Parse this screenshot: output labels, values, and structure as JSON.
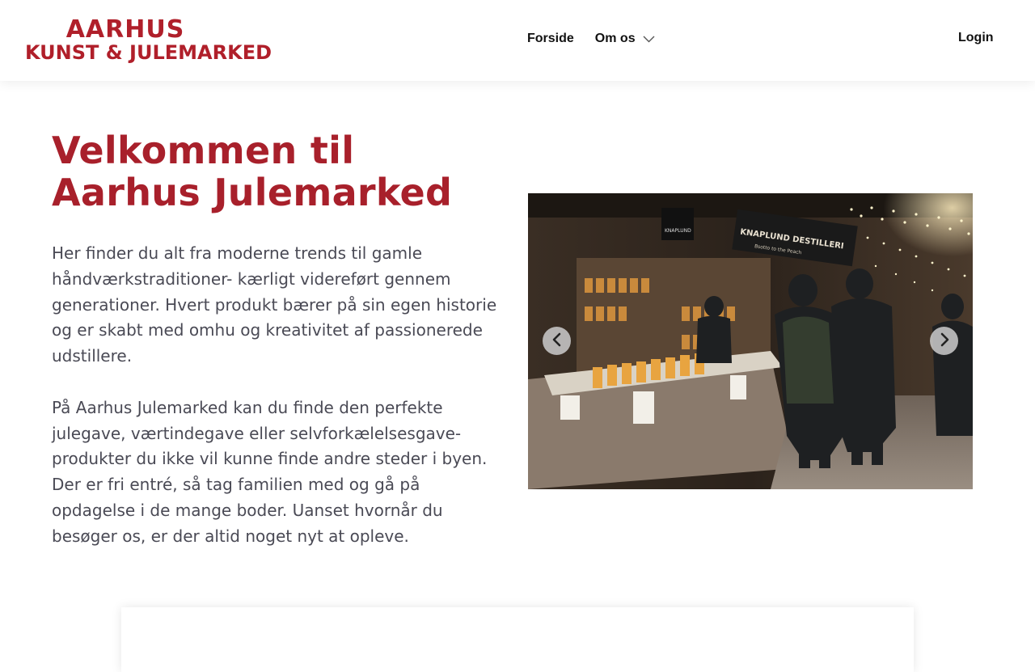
{
  "brand": {
    "logo_line1": "AARHUS",
    "logo_line2": "KUNST & JULEMARKED",
    "accent_color": "#a8202b"
  },
  "nav": {
    "items": [
      {
        "label": "Forside"
      },
      {
        "label": "Om os",
        "icon": "chevron-down-icon"
      }
    ],
    "login_label": "Login"
  },
  "hero": {
    "title": "Velkommen til Aarhus Julemarked",
    "paragraphs": [
      "Her finder du alt fra moderne trends til gamle håndværkstraditioner- kærligt videreført gennem generationer. Hvert produkt bærer på sin egen historie og er skabt med omhu og kreativitet af passionerede udstillere.",
      "På Aarhus Julemarked kan du finde den perfekte julegave, værtindegave eller selvforkælelsesgave-produkter du ikke vil kunne finde andre steder i byen. Der er fri entré, så tag familien med og gå på opdagelse i de mange boder. Uanset hvornår du besøger os, er der altid noget nyt at opleve."
    ]
  },
  "carousel": {
    "prev_icon": "chevron-left-icon",
    "next_icon": "chevron-right-icon",
    "sign_main": "KNAPLUND DESTILLERI",
    "sign_small": "KNAPLUND",
    "sign_sub": "Bsotto to the Peach"
  }
}
